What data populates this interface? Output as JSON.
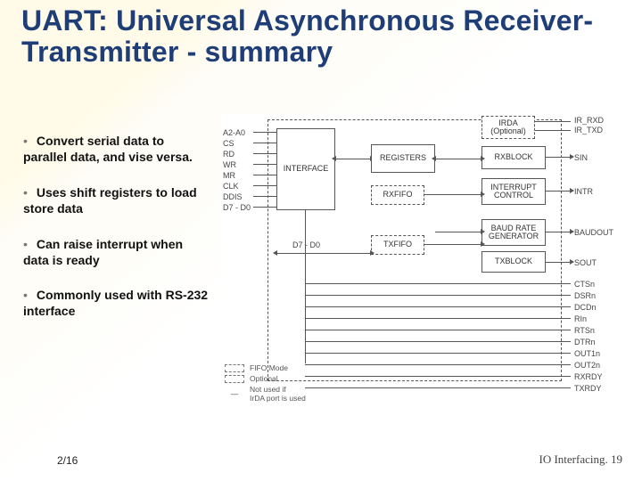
{
  "title": "UART: Universal Asynchronous Receiver-Transmitter - summary",
  "bullets": [
    "Convert serial data to parallel data, and vise versa.",
    "Uses shift registers to load store data",
    "Can raise interrupt when data is ready",
    "Commonly used with RS-232 interface"
  ],
  "date": "2/16",
  "footer": "IO Interfacing. 19",
  "diagram": {
    "left_pins": [
      "A2-A0",
      "CS",
      "RD",
      "WR",
      "MR",
      "CLK",
      "DDIS",
      "D7 - D0"
    ],
    "blocks": {
      "interface": "INTERFACE",
      "registers": "REGISTERS",
      "rxfifo": "RXFIFO",
      "txfifo": "TXFIFO",
      "irda": "IRDA\n(Optional)",
      "rxblock": "RXBLOCK",
      "intr_ctrl": "INTERRUPT\nCONTROL",
      "baud": "BAUD RATE\nGENERATOR",
      "txblock": "TXBLOCK"
    },
    "bus_label": "D7 - D0",
    "right_pins": [
      "IR_RXD",
      "IR_TXD",
      "SIN",
      "INTR",
      "BAUDOUT",
      "SOUT",
      "CTSn",
      "DSRn",
      "DCDn",
      "RIn",
      "RTSn",
      "DTRn",
      "OUT1n",
      "OUT2n",
      "RXRDY",
      "TXRDY"
    ],
    "legend": {
      "fifo": "FIFO Mode",
      "optional": "Optional",
      "notused": "Not used if\nIrDA port is used"
    }
  }
}
